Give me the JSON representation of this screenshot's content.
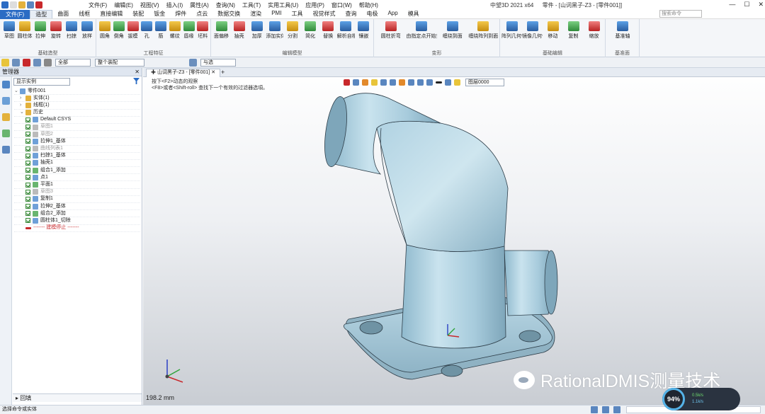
{
  "titlebar": {
    "menus": [
      "文件(F)",
      "编辑(E)",
      "视图(V)",
      "插入(I)",
      "属性(A)",
      "查询(N)",
      "工具(T)",
      "实用工具(U)",
      "应用(P)",
      "窗口(W)",
      "帮助(H)"
    ],
    "app_title": "中望3D 2021 x64",
    "doc_title": "零件 - [山词黑子-Z3 - [零件001]]"
  },
  "search": {
    "placeholder": "搜索命令"
  },
  "ribbon_tabs": {
    "file": "文件(F)",
    "items": [
      "造型",
      "曲面",
      "线框",
      "直接编辑",
      "装配",
      "钣金",
      "焊件",
      "点云",
      "数据交换",
      "渲染",
      "PMI",
      "工具",
      "视觉样式",
      "查询",
      "电极",
      "App",
      "模具"
    ]
  },
  "ribbon": {
    "groups": [
      {
        "label": "基础造型",
        "buttons": [
          "草图",
          "圆柱体",
          "拉伸",
          "旋转",
          "扫掠",
          "放样"
        ]
      },
      {
        "label": "工程特征",
        "buttons": [
          "圆角",
          "倒角",
          "拔模",
          "孔",
          "筋",
          "螺纹",
          "唇缘",
          "坯料"
        ]
      },
      {
        "label": "编辑模型",
        "buttons": [
          "面偏移",
          "抽壳",
          "加厚",
          "添加实体",
          "分割",
          "简化",
          "替换",
          "解析自相交",
          "镶嵌"
        ]
      },
      {
        "label": "变形",
        "buttons": [
          "圆柱折弯",
          "由指定点开始变形",
          "缠绕到面",
          "缠绕阵列到面"
        ]
      },
      {
        "label": "基础编辑",
        "buttons": [
          "阵列几何体",
          "镜像几何体",
          "移动",
          "复制",
          "缩放"
        ]
      },
      {
        "label": "基准面",
        "buttons": [
          "基准轴"
        ]
      }
    ]
  },
  "toolbar2": {
    "filter": "全部",
    "scope": "整个装配",
    "extra": "与选"
  },
  "left_panel": {
    "title": "管理器",
    "filter_value": "显示实例",
    "tree": [
      {
        "text": "零件001",
        "level": 0,
        "check": false,
        "icon": "part-icon",
        "tone": "normal"
      },
      {
        "text": "实体(1)",
        "level": 1,
        "check": false,
        "icon": "folder-icon",
        "tone": "normal"
      },
      {
        "text": "线框(1)",
        "level": 1,
        "check": false,
        "icon": "folder-icon",
        "tone": "normal"
      },
      {
        "text": "历史",
        "level": 1,
        "check": false,
        "icon": "folder-icon",
        "tone": "normal"
      },
      {
        "text": "Default CSYS",
        "level": 2,
        "check": true,
        "icon": "csys-icon",
        "tone": "normal"
      },
      {
        "text": "草图1",
        "level": 2,
        "check": true,
        "icon": "sketch-icon",
        "tone": "grey"
      },
      {
        "text": "草图2",
        "level": 2,
        "check": true,
        "icon": "sketch-icon",
        "tone": "grey"
      },
      {
        "text": "拉伸1_基体",
        "level": 2,
        "check": true,
        "icon": "extrude-icon",
        "tone": "normal"
      },
      {
        "text": "曲线列表1",
        "level": 2,
        "check": true,
        "icon": "curve-icon",
        "tone": "grey"
      },
      {
        "text": "扫掠1_基体",
        "level": 2,
        "check": true,
        "icon": "sweep-icon",
        "tone": "normal"
      },
      {
        "text": "抽壳1",
        "level": 2,
        "check": true,
        "icon": "shell-icon",
        "tone": "normal"
      },
      {
        "text": "组合1_添加",
        "level": 2,
        "check": true,
        "icon": "combine-icon",
        "tone": "normal"
      },
      {
        "text": "点1",
        "level": 2,
        "check": true,
        "icon": "point-icon",
        "tone": "normal"
      },
      {
        "text": "平面1",
        "level": 2,
        "check": true,
        "icon": "plane-icon",
        "tone": "normal"
      },
      {
        "text": "草图3",
        "level": 2,
        "check": true,
        "icon": "sketch-icon",
        "tone": "grey"
      },
      {
        "text": "复制1",
        "level": 2,
        "check": true,
        "icon": "copy-icon",
        "tone": "normal"
      },
      {
        "text": "拉伸2_基体",
        "level": 2,
        "check": true,
        "icon": "extrude-icon",
        "tone": "normal"
      },
      {
        "text": "组合2_添加",
        "level": 2,
        "check": true,
        "icon": "combine-icon",
        "tone": "normal"
      },
      {
        "text": "圆柱体1_切除",
        "level": 2,
        "check": true,
        "icon": "cylinder-icon",
        "tone": "normal"
      },
      {
        "text": "------- 建模停止 -------",
        "level": 2,
        "check": false,
        "icon": "stop-icon",
        "tone": "red"
      }
    ],
    "bottom_tab": "回填"
  },
  "viewport": {
    "tab_title": "山词黑子-Z3 - [零件001]",
    "hint_line1": "按下<F2>动态的观察",
    "hint_line2": "<F8>或者<Shift-roll> 查找下一个有效的过滤器选項。",
    "view_select": "图层0000",
    "scale": "198.2 mm",
    "watermark": "RationalDMIS测量技术"
  },
  "statusbar": {
    "text": "选择命令或实体"
  },
  "gauge": {
    "percent": "94%",
    "up": "0.5k/s",
    "down": "1.1k/s"
  },
  "colors": {
    "model": "#a9cfdf",
    "file_tab": "#2b6cc4",
    "accent": "#2b6cc4"
  }
}
